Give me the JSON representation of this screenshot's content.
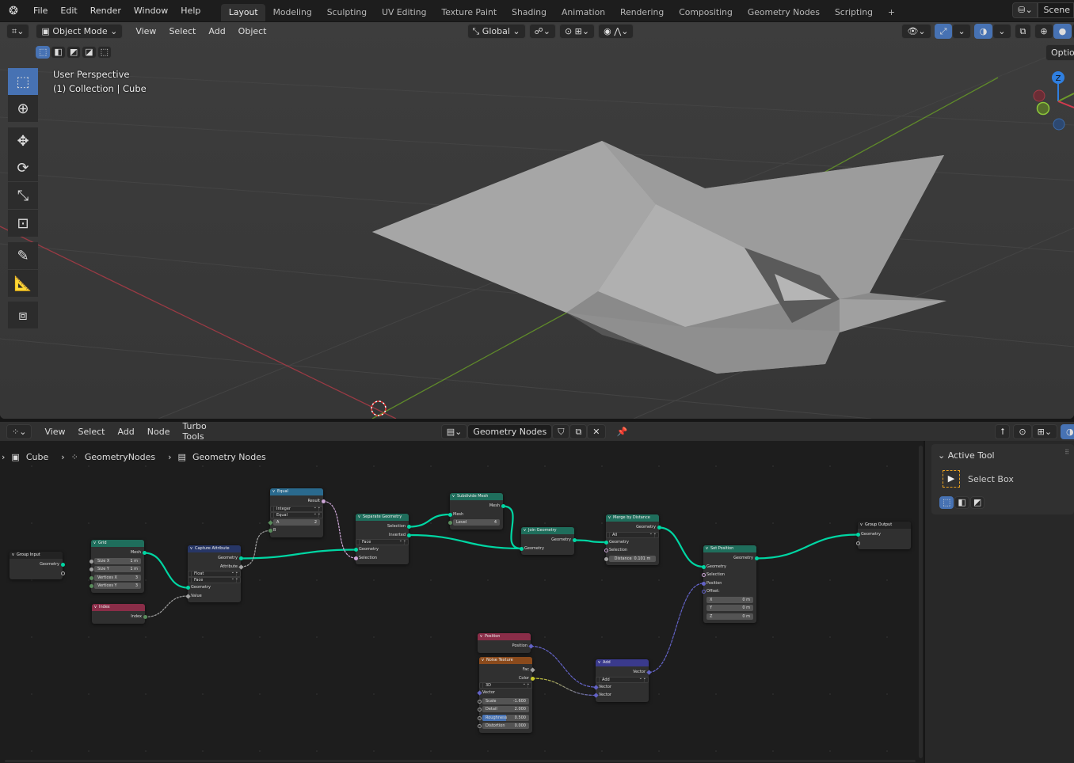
{
  "topbar": {
    "logo": "blender-logo",
    "menus": [
      "File",
      "Edit",
      "Render",
      "Window",
      "Help"
    ],
    "workspaces": [
      "Layout",
      "Modeling",
      "Sculpting",
      "UV Editing",
      "Texture Paint",
      "Shading",
      "Animation",
      "Rendering",
      "Compositing",
      "Geometry Nodes",
      "Scripting"
    ],
    "active_workspace": "Layout",
    "add_tab": "+",
    "scene": "Scene"
  },
  "viewport": {
    "mode": "Object Mode",
    "menus": [
      "View",
      "Select",
      "Add",
      "Object"
    ],
    "transform_orientation": "Global",
    "overlay_line1": "User Perspective",
    "overlay_line2": "(1) Collection | Cube",
    "options": "Options",
    "tools": [
      "select-box",
      "cursor",
      "move",
      "rotate",
      "scale",
      "transform",
      "annotate",
      "measure",
      "add-cube"
    ],
    "gizmo_axis": "Z",
    "colors": {
      "x_axis": "#a33a46",
      "y_axis": "#6c9a2a",
      "z_axis": "#2f7fe0",
      "accent": "#4772b3"
    }
  },
  "node_editor": {
    "menus": [
      "View",
      "Select",
      "Add",
      "Node",
      "Turbo Tools"
    ],
    "tree_name": "Geometry Nodes",
    "breadcrumb": [
      "Cube",
      "GeometryNodes",
      "Geometry Nodes"
    ],
    "nodes": [
      {
        "title": "Group Input",
        "color": "#232323",
        "rows": [
          {
            "t": "out",
            "l": "Geometry",
            "s": "geo"
          },
          {
            "t": "out",
            "l": "",
            "s": "hollow"
          }
        ]
      },
      {
        "title": "Grid",
        "color": "#1f6e5c",
        "rows": [
          {
            "t": "out",
            "l": "Mesh",
            "s": "geo"
          },
          {
            "t": "field",
            "l": "Size X",
            "v": "1 m",
            "s": "float"
          },
          {
            "t": "field",
            "l": "Size Y",
            "v": "1 m",
            "s": "float"
          },
          {
            "t": "field",
            "l": "Vertices X",
            "v": "3",
            "s": "int"
          },
          {
            "t": "field",
            "l": "Vertices Y",
            "v": "3",
            "s": "int"
          }
        ]
      },
      {
        "title": "Index",
        "color": "#8a2d48",
        "rows": [
          {
            "t": "out",
            "l": "Index",
            "s": "int"
          }
        ]
      },
      {
        "title": "Capture Attribute",
        "color": "#273666",
        "rows": [
          {
            "t": "out",
            "l": "Geometry",
            "s": "geo"
          },
          {
            "t": "out",
            "l": "Attribute",
            "s": "floatd"
          },
          {
            "t": "sel",
            "l": "Float"
          },
          {
            "t": "sel",
            "l": "Face"
          },
          {
            "t": "in",
            "l": "Geometry",
            "s": "geo"
          },
          {
            "t": "in",
            "l": "Value",
            "s": "floatd"
          }
        ]
      },
      {
        "title": "Equal",
        "color": "#2a6a8e",
        "rows": [
          {
            "t": "out",
            "l": "Result",
            "s": "bool"
          },
          {
            "t": "sel",
            "l": "Integer"
          },
          {
            "t": "sel",
            "l": "Equal"
          },
          {
            "t": "field",
            "l": "A",
            "v": "2",
            "s": "intd"
          },
          {
            "t": "in",
            "l": "B",
            "s": "int"
          }
        ]
      },
      {
        "title": "Separate Geometry",
        "color": "#1f6e5c",
        "rows": [
          {
            "t": "out",
            "l": "Selection",
            "s": "geo"
          },
          {
            "t": "out",
            "l": "Inverted",
            "s": "geo"
          },
          {
            "t": "sel",
            "l": "Face"
          },
          {
            "t": "in",
            "l": "Geometry",
            "s": "geo"
          },
          {
            "t": "in",
            "l": "Selection",
            "s": "bool"
          }
        ]
      },
      {
        "title": "Subdivide Mesh",
        "color": "#1f6e5c",
        "rows": [
          {
            "t": "out",
            "l": "Mesh",
            "s": "geo"
          },
          {
            "t": "in",
            "l": "Mesh",
            "s": "geo"
          },
          {
            "t": "field",
            "l": "Level",
            "v": "4",
            "s": "int"
          }
        ]
      },
      {
        "title": "Join Geometry",
        "color": "#1f6e5c",
        "rows": [
          {
            "t": "out",
            "l": "Geometry",
            "s": "geo"
          },
          {
            "t": "in",
            "l": "Geometry",
            "s": "geo"
          }
        ]
      },
      {
        "title": "Merge by Distance",
        "color": "#1f6e5c",
        "rows": [
          {
            "t": "out",
            "l": "Geometry",
            "s": "geo"
          },
          {
            "t": "sel",
            "l": "All"
          },
          {
            "t": "in",
            "l": "Geometry",
            "s": "geo"
          },
          {
            "t": "in",
            "l": "Selection",
            "s": "boolh"
          },
          {
            "t": "field",
            "l": "Distance",
            "v": "0.101 m",
            "s": "float",
            "c": true
          }
        ]
      },
      {
        "title": "Set Position",
        "color": "#1f6e5c",
        "rows": [
          {
            "t": "out",
            "l": "Geometry",
            "s": "geo"
          },
          {
            "t": "in",
            "l": "Geometry",
            "s": "geo"
          },
          {
            "t": "in",
            "l": "Selection",
            "s": "boolh"
          },
          {
            "t": "in",
            "l": "Position",
            "s": "vec"
          },
          {
            "t": "in",
            "l": "Offset:",
            "s": "vech"
          },
          {
            "t": "field",
            "l": "X",
            "v": "0 m"
          },
          {
            "t": "field",
            "l": "Y",
            "v": "0 m"
          },
          {
            "t": "field",
            "l": "Z",
            "v": "0 m"
          }
        ]
      },
      {
        "title": "Group Output",
        "color": "#232323",
        "rows": [
          {
            "t": "in",
            "l": "Geometry",
            "s": "geo"
          },
          {
            "t": "in",
            "l": "",
            "s": "hollow"
          }
        ]
      },
      {
        "title": "Position",
        "color": "#8a2d48",
        "rows": [
          {
            "t": "out",
            "l": "Position",
            "s": "vecd"
          }
        ]
      },
      {
        "title": "Noise Texture",
        "color": "#8a4a1c",
        "rows": [
          {
            "t": "out",
            "l": "Fac",
            "s": "floatd"
          },
          {
            "t": "out",
            "l": "Color",
            "s": "col"
          },
          {
            "t": "sel",
            "l": "3D"
          },
          {
            "t": "in",
            "l": "Vector",
            "s": "vecd"
          },
          {
            "t": "field",
            "l": "Scale",
            "v": "-1.600",
            "s": "floath"
          },
          {
            "t": "field",
            "l": "Detail",
            "v": "2.000",
            "s": "floath"
          },
          {
            "t": "field",
            "l": "Roughness",
            "v": "0.500",
            "s": "floath",
            "fill": 0.5
          },
          {
            "t": "field",
            "l": "Distortion",
            "v": "0.000",
            "s": "floath"
          }
        ]
      },
      {
        "title": "Add",
        "color": "#3a3a8c",
        "rows": [
          {
            "t": "out",
            "l": "Vector",
            "s": "vecd"
          },
          {
            "t": "sel",
            "l": "Add"
          },
          {
            "t": "in",
            "l": "Vector",
            "s": "vecd"
          },
          {
            "t": "in",
            "l": "Vector",
            "s": "vecd"
          }
        ]
      }
    ],
    "links": [
      [
        1,
        0,
        3,
        4,
        "geo"
      ],
      [
        2,
        0,
        3,
        5,
        "grey"
      ],
      [
        3,
        0,
        5,
        3,
        "geo"
      ],
      [
        3,
        1,
        4,
        4,
        "grey"
      ],
      [
        4,
        0,
        5,
        4,
        "bool"
      ],
      [
        5,
        0,
        6,
        1,
        "geo"
      ],
      [
        5,
        1,
        7,
        1,
        "geo"
      ],
      [
        6,
        0,
        7,
        1,
        "geo"
      ],
      [
        7,
        0,
        8,
        2,
        "geo"
      ],
      [
        8,
        0,
        9,
        1,
        "geo"
      ],
      [
        9,
        0,
        10,
        0,
        "geo"
      ],
      [
        11,
        0,
        13,
        2,
        "vec"
      ],
      [
        12,
        1,
        13,
        3,
        "col"
      ],
      [
        13,
        0,
        9,
        3,
        "vec"
      ]
    ],
    "socket_colors": {
      "geo": "#00d6a3",
      "float": "#a1a1a1",
      "int": "#598c5c",
      "bool": "#cca6d6",
      "vec": "#6363c7",
      "col": "#c7c729",
      "grey": "#a1a1a1"
    }
  },
  "sidebar": {
    "panel_title": "Active Tool",
    "tool_name": "Select Box"
  }
}
